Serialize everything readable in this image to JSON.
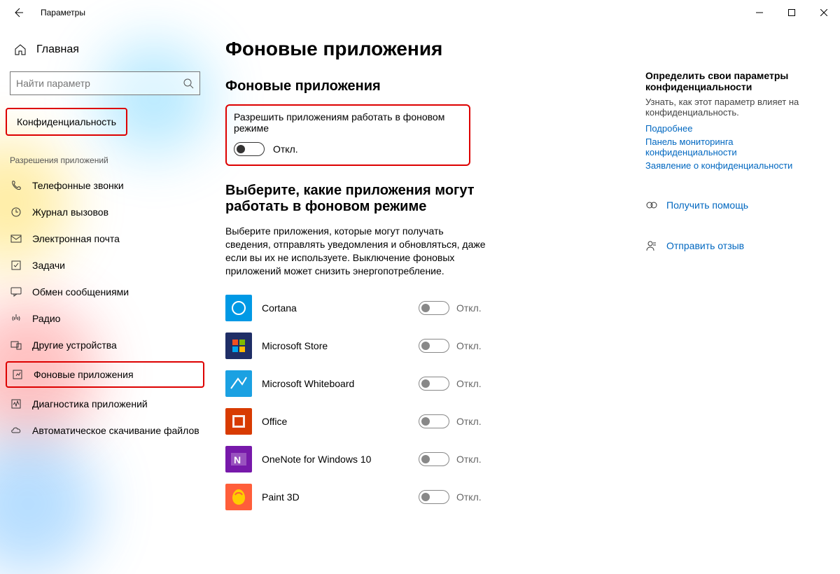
{
  "app_title": "Параметры",
  "sidebar": {
    "home": "Главная",
    "search_placeholder": "Найти параметр",
    "category": "Конфиденциальность",
    "group": "Разрешения приложений",
    "items": [
      {
        "label": "Телефонные звонки"
      },
      {
        "label": "Журнал вызовов"
      },
      {
        "label": "Электронная почта"
      },
      {
        "label": "Задачи"
      },
      {
        "label": "Обмен сообщениями"
      },
      {
        "label": "Радио"
      },
      {
        "label": "Другие устройства"
      },
      {
        "label": "Фоновые приложения"
      },
      {
        "label": "Диагностика приложений"
      },
      {
        "label": "Автоматическое скачивание файлов"
      }
    ]
  },
  "main": {
    "title": "Фоновые приложения",
    "section1_title": "Фоновые приложения",
    "allow_label": "Разрешить приложениям работать в фоновом режиме",
    "master_state": "Откл.",
    "section2_title": "Выберите, какие приложения могут работать в фоновом режиме",
    "description": "Выберите приложения, которые могут получать сведения, отправлять уведомления и обновляться, даже если вы их не используете. Выключение фоновых приложений может снизить энергопотребление.",
    "apps": [
      {
        "name": "Cortana",
        "state": "Откл.",
        "bg": "#0099e5"
      },
      {
        "name": "Microsoft Store",
        "state": "Откл.",
        "bg": "#1f2e66"
      },
      {
        "name": "Microsoft Whiteboard",
        "state": "Откл.",
        "bg": "#1ba1e2"
      },
      {
        "name": "Office",
        "state": "Откл.",
        "bg": "#d83b01"
      },
      {
        "name": "OneNote for Windows 10",
        "state": "Откл.",
        "bg": "#7719aa"
      },
      {
        "name": "Paint 3D",
        "state": "Откл.",
        "bg": "#ff5e3a"
      }
    ]
  },
  "right": {
    "heading": "Определить свои параметры конфиденциальности",
    "para": "Узнать, как этот параметр влияет на конфиденциальность.",
    "links": [
      "Подробнее",
      "Панель мониторинга конфиденциальности",
      "Заявление о конфиденциальности"
    ],
    "help": "Получить помощь",
    "feedback": "Отправить отзыв"
  }
}
